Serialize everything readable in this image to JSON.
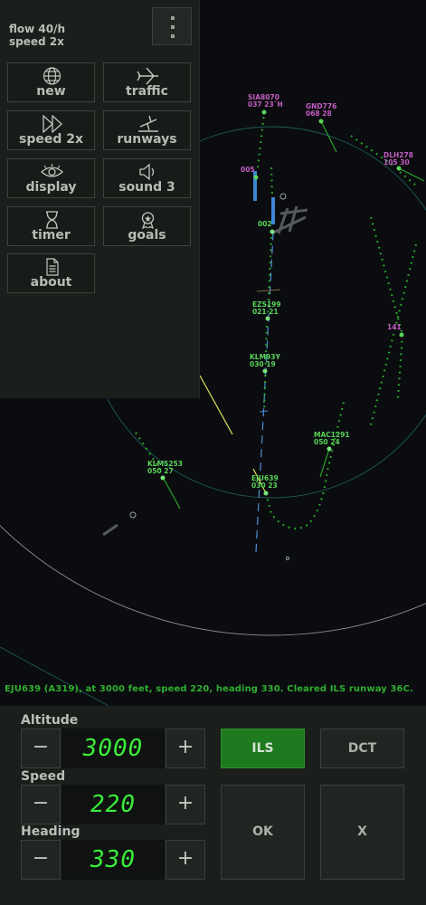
{
  "status": {
    "flow": "flow 40/h",
    "speed": "speed 2x"
  },
  "menu": [
    {
      "label": "new",
      "icon": "globe-icon"
    },
    {
      "label": "traffic",
      "icon": "airplane-icon"
    },
    {
      "label": "speed 2x",
      "icon": "fast-forward-icon"
    },
    {
      "label": "runways",
      "icon": "runway-plane-icon"
    },
    {
      "label": "display",
      "icon": "eye-icon"
    },
    {
      "label": "sound 3",
      "icon": "speaker-icon"
    },
    {
      "label": "timer",
      "icon": "hourglass-icon"
    },
    {
      "label": "goals",
      "icon": "award-icon"
    },
    {
      "label": "about",
      "icon": "document-icon"
    }
  ],
  "aircraft": [
    {
      "callsign": "SIA8070",
      "data": "037  23ˇH",
      "color": "#c45dc4"
    },
    {
      "callsign": "GND776",
      "data": "068  28",
      "color": "#c45dc4"
    },
    {
      "callsign": "DLH278",
      "data": "105  30",
      "color": "#c45dc4"
    },
    {
      "callsign": "005",
      "data": "",
      "color": "#c45dc4"
    },
    {
      "callsign": "002",
      "data": "",
      "color": "#5ad35a"
    },
    {
      "callsign": "EZS199",
      "data": "021  21",
      "color": "#5ad35a"
    },
    {
      "callsign": "141",
      "data": "",
      "color": "#c45dc4"
    },
    {
      "callsign": "KLM93Y",
      "data": "030  19",
      "color": "#5ad35a"
    },
    {
      "callsign": "MAC1291",
      "data": "050  24",
      "color": "#5ad35a"
    },
    {
      "callsign": "KLM5253",
      "data": "050  27",
      "color": "#5ad35a"
    },
    {
      "callsign": "EJU639",
      "data": "030  23",
      "color": "#5ad35a"
    }
  ],
  "message": "EJU639 (A319), at 3000 feet, speed 220, heading 330. Cleared ILS runway 36C.",
  "controls": {
    "altitude": {
      "label": "Altitude",
      "value": "3000"
    },
    "speed": {
      "label": "Speed",
      "value": "220"
    },
    "heading": {
      "label": "Heading",
      "value": "330"
    },
    "minus": "−",
    "plus": "+",
    "ils": "ILS",
    "dct": "DCT",
    "ok": "OK",
    "cancel": "X"
  },
  "colors": {
    "background": "#0b0c0f",
    "panel": "#1b1f1c",
    "lcd_text": "#3aee3a",
    "ils_active": "#1e7a1e",
    "selected_track": "#e0e060",
    "inbound": "#c45dc4",
    "controlled": "#5ad35a"
  }
}
